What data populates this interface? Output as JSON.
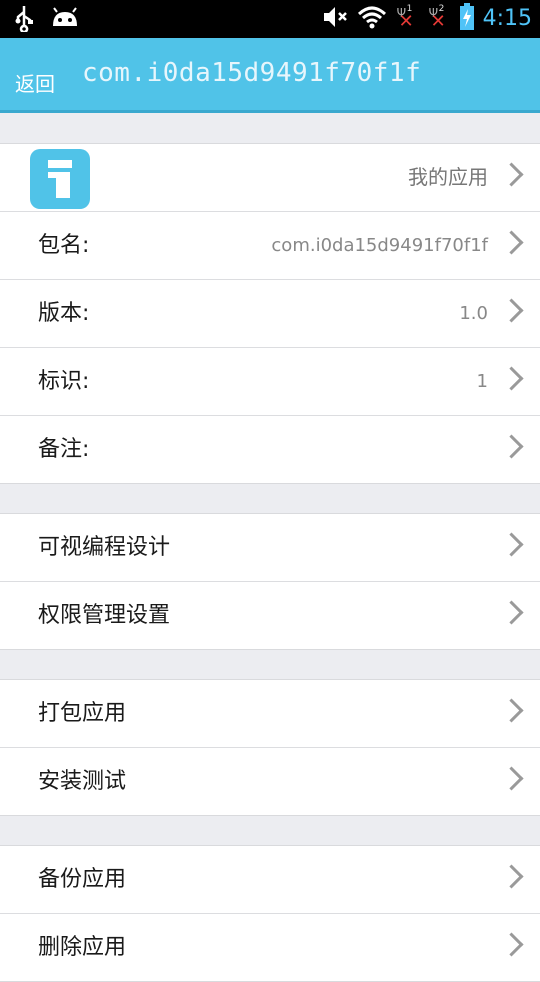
{
  "status_bar": {
    "time": "4:15",
    "sim1_number": "1",
    "sim2_number": "2",
    "icons": [
      "usb-icon",
      "android-icon",
      "mute-icon",
      "wifi-icon",
      "signal-off-icon",
      "battery-charging-icon"
    ]
  },
  "header": {
    "back_label": "返回",
    "title": "com.i0da15d9491f70f1f"
  },
  "app_info": {
    "my_apps_label": "我的应用",
    "rows": [
      {
        "label": "包名:",
        "value": "com.i0da15d9491f70f1f"
      },
      {
        "label": "版本:",
        "value": "1.0"
      },
      {
        "label": "标识:",
        "value": "1"
      },
      {
        "label": "备注:",
        "value": ""
      }
    ]
  },
  "design_group": {
    "visual_programming": "可视编程设计",
    "permission_settings": "权限管理设置"
  },
  "build_group": {
    "package_app": "打包应用",
    "install_test": "安装测试"
  },
  "manage_group": {
    "backup_app": "备份应用",
    "delete_app": "删除应用"
  },
  "colors": {
    "accent": "#50c3e8",
    "background": "#ecedf1",
    "time": "#4fc3f7"
  }
}
